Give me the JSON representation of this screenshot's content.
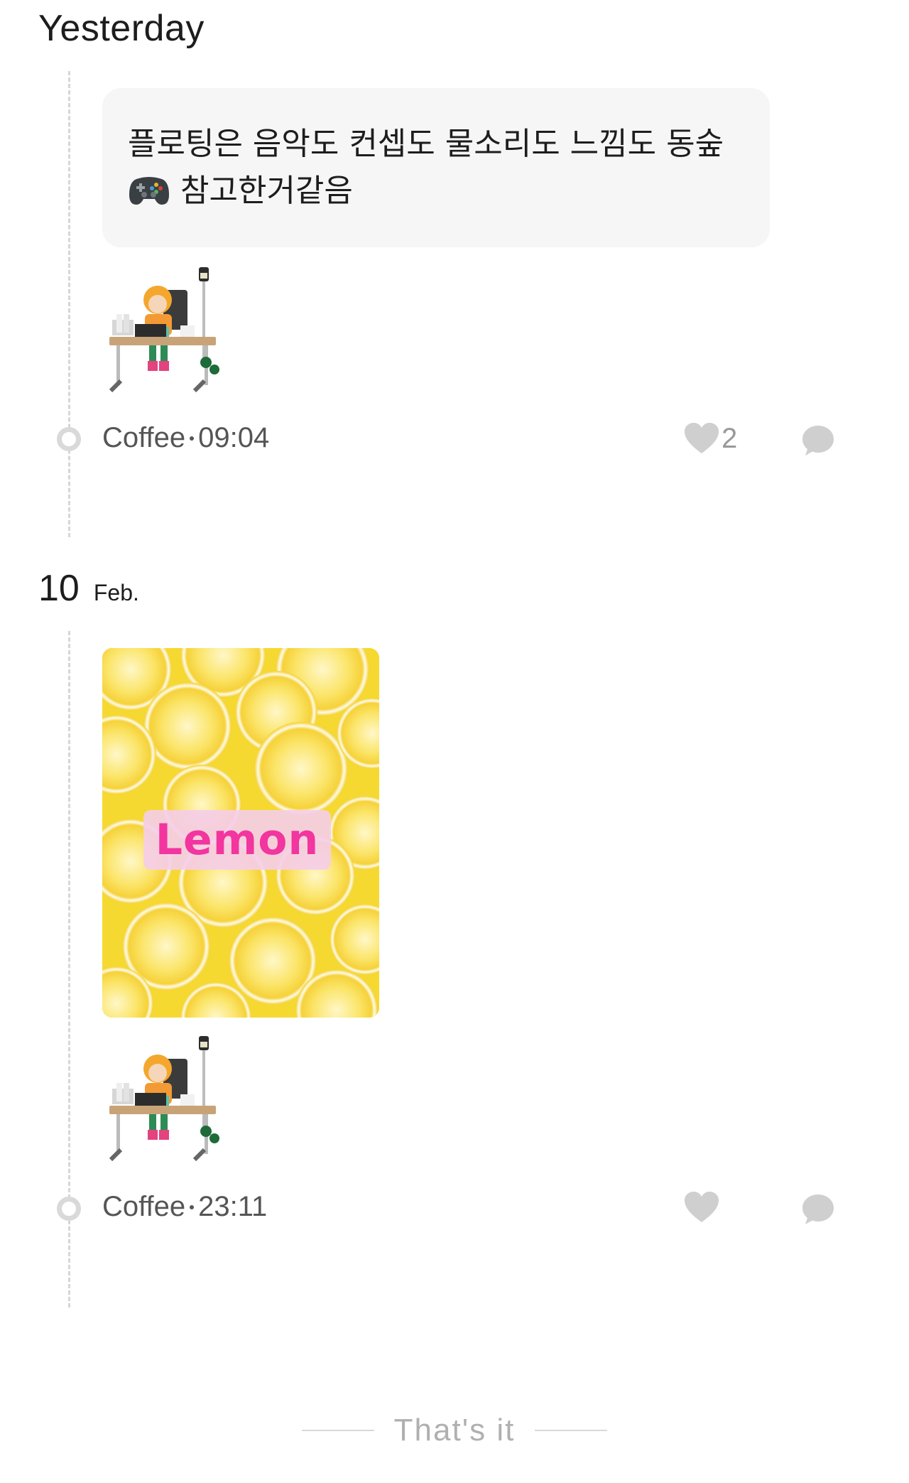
{
  "sections": [
    {
      "title": "Yesterday",
      "post": {
        "message_line1": "플로팅은 음악도 컨셉도 물소리도 느낌도 동숲",
        "message_line2": "참고한거같음",
        "emoji_icon": "gamepad-icon",
        "sticker": "desk-character-sticker",
        "author": "Coffee",
        "time": "09:04",
        "like_count": "2",
        "icons": {
          "like": "heart-icon",
          "comment": "comment-bubble-icon"
        }
      }
    },
    {
      "title_day": "10",
      "title_month": "Feb.",
      "post": {
        "image_caption": "Lemon",
        "sticker": "desk-character-sticker",
        "author": "Coffee",
        "time": "23:11",
        "like_count": "",
        "icons": {
          "like": "heart-icon",
          "comment": "comment-bubble-icon"
        }
      }
    }
  ],
  "footer": {
    "end_text": "That's it"
  },
  "colors": {
    "bubble_bg": "#f6f6f6",
    "text": "#1d1d1d",
    "meta_text": "#555555",
    "icon_gray": "#cfcfcf",
    "lemon_label_text": "#f2359f",
    "lemon_label_bg": "#f5cdeb"
  }
}
